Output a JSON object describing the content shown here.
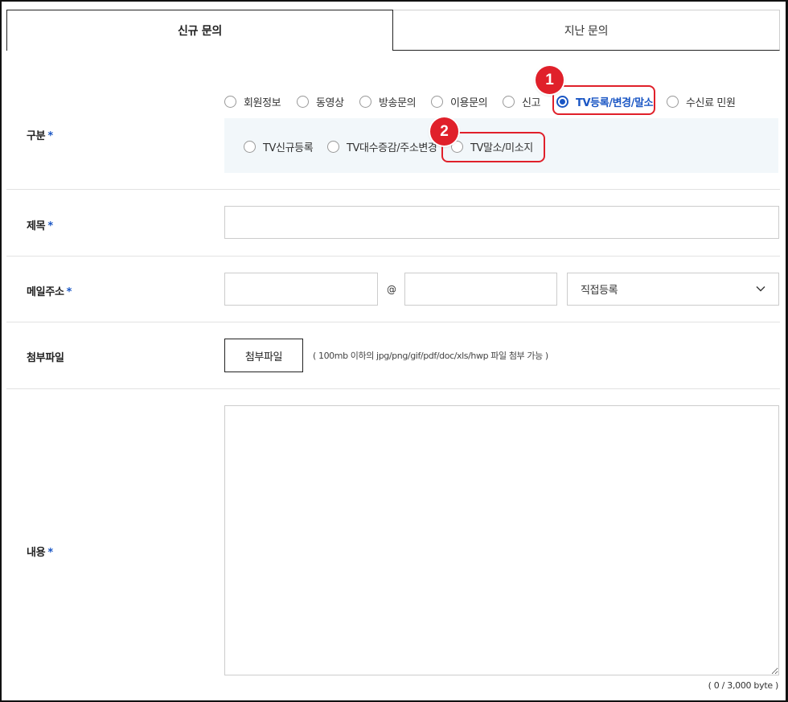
{
  "tabs": [
    {
      "label": "신규 문의",
      "active": true
    },
    {
      "label": "지난 문의",
      "active": false
    }
  ],
  "category": {
    "label": "구분",
    "required_mark": "*",
    "options": [
      {
        "label": "회원정보",
        "checked": false
      },
      {
        "label": "동영상",
        "checked": false
      },
      {
        "label": "방송문의",
        "checked": false
      },
      {
        "label": "이용문의",
        "checked": false
      },
      {
        "label": "신고",
        "checked": false
      },
      {
        "label": "TV등록/변경/말소",
        "checked": true
      },
      {
        "label": "수신료 민원",
        "checked": false
      }
    ],
    "sub_options": [
      {
        "label": "TV신규등록",
        "checked": false
      },
      {
        "label": "TV대수증감/주소변경",
        "checked": false
      },
      {
        "label": "TV말소/미소지",
        "checked": false
      }
    ]
  },
  "callouts": [
    "1",
    "2"
  ],
  "title_field": {
    "label": "제목",
    "required_mark": "*",
    "value": "",
    "placeholder": ""
  },
  "email": {
    "label": "메일주소",
    "required_mark": "*",
    "local_value": "",
    "at_symbol": "@",
    "domain_value": "",
    "select_value": "직접등록"
  },
  "attachment": {
    "label": "첨부파일",
    "button_label": "첨부파일",
    "note": "( 100mb 이하의 jpg/png/gif/pdf/doc/xls/hwp 파일 첨부 가능 )"
  },
  "content": {
    "label": "내용",
    "required_mark": "*",
    "value": "",
    "byte_counter": "( 0 / 3,000 byte )"
  },
  "colors": {
    "accent": "#1a56c4",
    "callout": "#e0202a",
    "subbox": "#f2f7fa"
  }
}
